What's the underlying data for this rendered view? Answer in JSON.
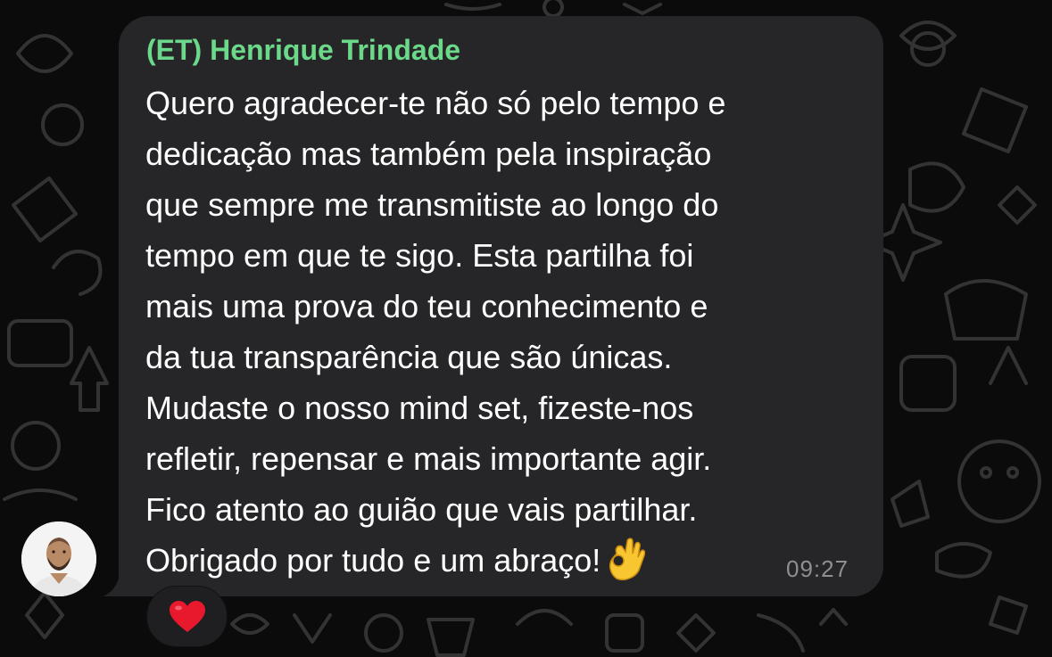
{
  "chat": {
    "sender_name": "(ET) Henrique Trindade",
    "message_lines": [
      "Quero agradecer-te não só pelo tempo e",
      "dedicação mas também pela inspiração",
      "que sempre me transmitiste ao longo do",
      "tempo em que te sigo. Esta partilha foi",
      "mais uma prova do teu conhecimento e",
      "da tua transparência que são únicas.",
      "Mudaste o nosso mind set, fizeste-nos",
      "refletir, repensar e mais importante agir.",
      "Fico atento ao guião que vais partilhar.",
      "Obrigado por tudo e um abraço!"
    ],
    "trailing_emoji": "ok-hand-emoji",
    "timestamp": "09:27",
    "reaction": "heart-emoji"
  },
  "colors": {
    "background": "#0b0b0b",
    "bubble": "#262628",
    "sender_name": "#6cd98a",
    "message_text": "#ffffff",
    "timestamp": "#8e8e93",
    "reaction_heart": "#e8192c"
  }
}
